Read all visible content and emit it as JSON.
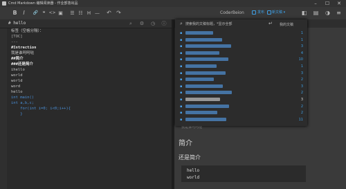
{
  "window": {
    "title": "Cmd Markdown 编辑阅读器 - 作业部落出品",
    "controls": {
      "minimize": "–",
      "maximize": "☐",
      "close": "✕"
    }
  },
  "toolbar": {
    "bold": "B",
    "italic": "I",
    "link": "🔗",
    "quote": "❝",
    "code": "<>",
    "image": "▣",
    "ol": "☰",
    "ul": "☷",
    "heading": "H",
    "hr": "—",
    "undo": "↶",
    "redo": "↷",
    "center_label": "CoderBeion",
    "publish": "发布",
    "new_doc": "新文稿 ▾"
  },
  "editor": {
    "tab": "# hello",
    "lines": [
      "",
      "标签（空格分隔）：",
      "",
      "[TOC]",
      "",
      "---",
      "#Intrection",
      "我是谁呵呵哒",
      "##简介",
      "###还是简介",
      "ihello",
      "world",
      "world",
      "word",
      "hello",
      "",
      "",
      "int main()",
      "int a,b,c;",
      "    for(int i=0; i<0;i++){",
      "",
      "",
      "",
      "    }"
    ]
  },
  "preview": {
    "h2": "简介",
    "h3": "还是简介",
    "code_lines": [
      "hello",
      "world"
    ],
    "partial_text": "我是谁呵呵哒"
  },
  "popup": {
    "search_placeholder": "搜索我的文稿标题，*显示全部",
    "enter_icon": "↵",
    "title": "我的文稿",
    "items": [
      {
        "count": "1",
        "active": false
      },
      {
        "count": "1",
        "active": false
      },
      {
        "count": "3",
        "active": false
      },
      {
        "count": "4",
        "active": false
      },
      {
        "count": "10",
        "active": false
      },
      {
        "count": "1",
        "active": false
      },
      {
        "count": "3",
        "active": false
      },
      {
        "count": "2",
        "active": false
      },
      {
        "count": "3",
        "active": false
      },
      {
        "count": "2",
        "active": false
      },
      {
        "count": "3",
        "active": true
      },
      {
        "count": "2",
        "active": false
      },
      {
        "count": "2",
        "active": false
      },
      {
        "count": "11",
        "active": false
      }
    ]
  },
  "colors": {
    "accent": "#3ea0e6",
    "editor_bg": "#2a2a2a",
    "preview_bg": "#3a3a3a",
    "popup_bg": "#2c2c2c"
  }
}
